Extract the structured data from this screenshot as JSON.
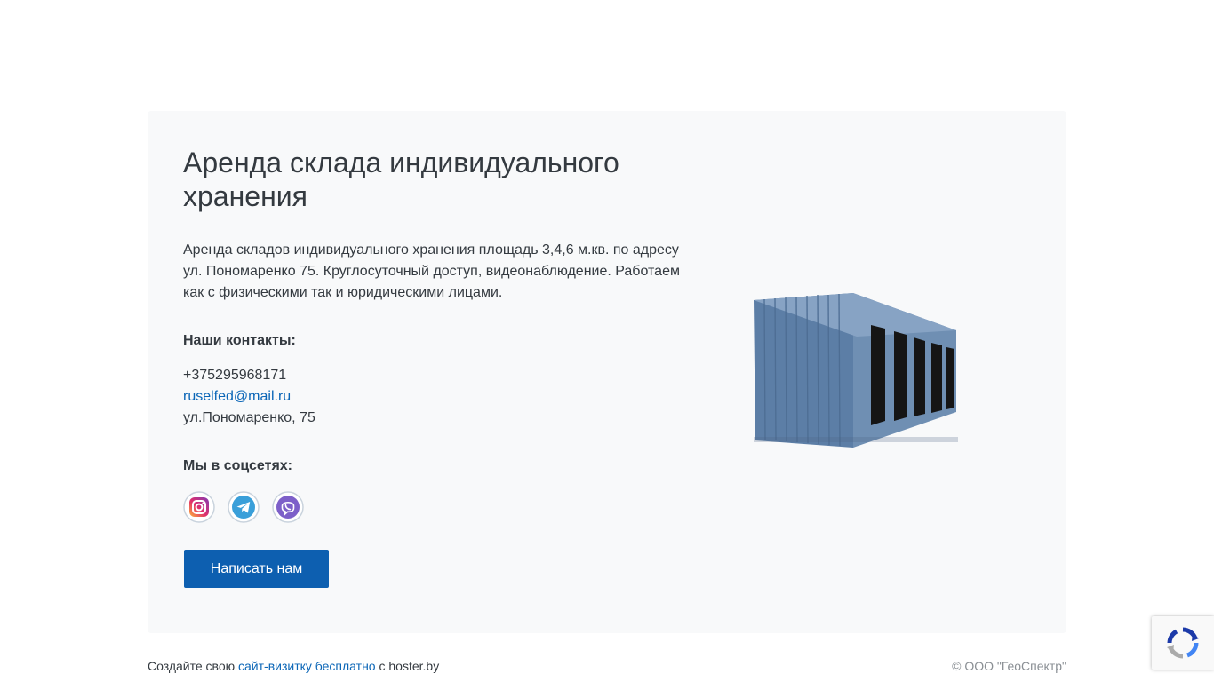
{
  "main": {
    "title": "Аренда склада индивидуального хранения",
    "description": "Аренда складов индивидуального хранения площадь 3,4,6 м.кв. по адресу ул. Пономаренко 75. Круглосуточный доступ, видеонаблюдение. Работаем как с физическими так и юридическими лицами.",
    "contacts_heading": "Наши контакты:",
    "phone": "+375295968171",
    "email": "ruselfed@mail.ru",
    "address": "ул.Пономаренко, 75",
    "social_heading": "Мы в соцсетях:",
    "social_icons": [
      "instagram-icon",
      "telegram-icon",
      "viber-icon"
    ],
    "button_label": "Написать нам"
  },
  "footer": {
    "left_prefix": "Создайте свою",
    "left_link": "сайт-визитку бесплатно",
    "left_suffix": "с hoster.by",
    "copyright": "© ООО \"ГеоСпектр\""
  },
  "colors": {
    "accent": "#0d5fb0",
    "link": "#0b66b7",
    "card_bg": "#f8f9fa",
    "text": "#343a40"
  }
}
